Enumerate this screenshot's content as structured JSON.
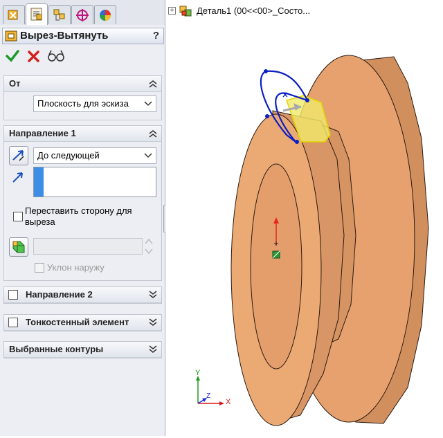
{
  "feature_manager": {
    "tabs": [
      "feature-manager-tab",
      "property-manager-tab",
      "configuration-manager-tab",
      "dimxpert-tab",
      "display-manager-tab"
    ],
    "active_tab": 1
  },
  "property_manager": {
    "title": "Вырез-Вытянуть",
    "help": "?",
    "actions": [
      "ok",
      "cancel",
      "preview"
    ]
  },
  "from_group": {
    "title": "От",
    "start": "Плоскость для эскиза"
  },
  "direction1": {
    "title": "Направление 1",
    "end_condition": "До следующей",
    "direction_value": "",
    "flip_side_label": "Переставить сторону для\nвыреза",
    "flip_side_checked": false,
    "draft_value": "",
    "draft_outward_label": "Уклон наружу",
    "draft_outward_enabled": false
  },
  "collapsed_groups": [
    {
      "title": "Направление 2",
      "checkbox": true
    },
    {
      "title": "Тонкостенный элемент",
      "checkbox": true
    },
    {
      "title": "Выбранные контуры",
      "checkbox": false
    }
  ],
  "tree": {
    "root_label": "Деталь1  (00<<00>_Состо..."
  },
  "triad": {
    "x": "X",
    "y": "Y",
    "z": "Z"
  },
  "colors": {
    "part_face": "#e9a472",
    "part_edge": "#2a1a10",
    "sketch": "#0a1fc4",
    "preview": "#ece24a",
    "accent": "#2f7fd0"
  }
}
